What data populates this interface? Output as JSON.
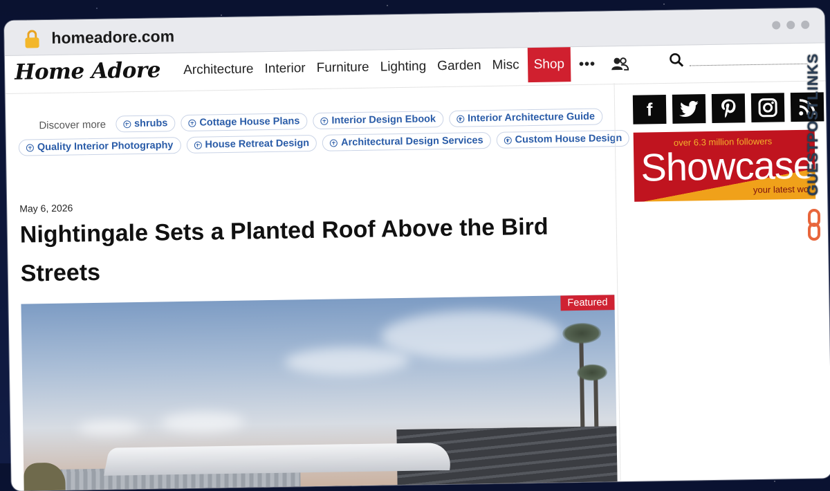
{
  "browser": {
    "url": "homeadore.com"
  },
  "header": {
    "logo": "Home Adore",
    "nav": [
      {
        "label": "Architecture"
      },
      {
        "label": "Interior"
      },
      {
        "label": "Furniture"
      },
      {
        "label": "Lighting"
      },
      {
        "label": "Garden"
      },
      {
        "label": "Misc"
      }
    ],
    "shop_label": "Shop",
    "more_label": "•••",
    "search_placeholder": ""
  },
  "discover": {
    "label": "Discover more",
    "row1": [
      "shrubs",
      "Cottage House Plans",
      "Interior Design Ebook",
      "Interior Architecture Guide"
    ],
    "row2": [
      "Quality Interior Photography",
      "House Retreat Design",
      "Architectural Design Services",
      "Custom House Design"
    ]
  },
  "article": {
    "date": "May 6, 2026",
    "title": "Nightingale Sets a Planted Roof Above the Bird Streets",
    "badge": "Featured"
  },
  "sidebar": {
    "social": [
      {
        "icon": "facebook-icon",
        "glyph": "f"
      },
      {
        "icon": "twitter-icon",
        "glyph": "🐦"
      },
      {
        "icon": "pinterest-icon",
        "glyph": "P"
      },
      {
        "icon": "instagram-icon",
        "glyph": "◎"
      },
      {
        "icon": "rss-icon",
        "glyph": ")"
      }
    ],
    "banner": {
      "top": "over 6.3 million followers",
      "main": "Showcase",
      "bottom": "your latest wo"
    }
  },
  "overlay": {
    "brand_a": "GUESTPOST",
    "brand_b": "LINKS"
  },
  "colors": {
    "accent_red": "#d0202f",
    "chip_blue": "#2a5ca8"
  }
}
